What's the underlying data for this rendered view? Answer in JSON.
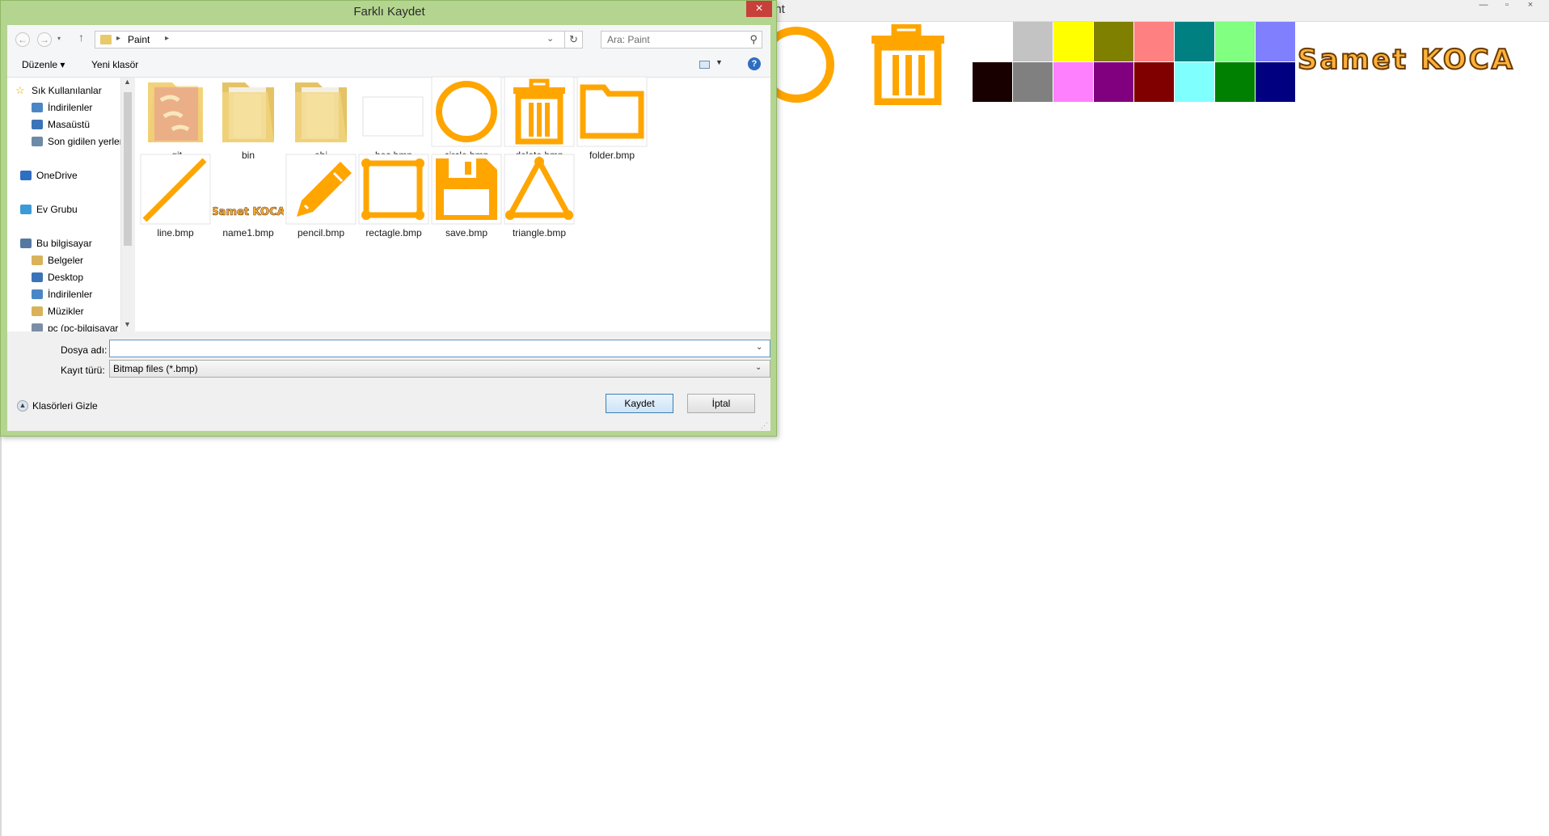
{
  "paint_app": {
    "title_fragment": "int",
    "logo_text": "Samet KOCA",
    "palette": [
      "#c3c3c3",
      "#ffff00",
      "#808000",
      "#ff8080",
      "#008080",
      "#80ff80",
      "#8080ff",
      "#180000",
      "#808080",
      "#ff80ff",
      "#800080",
      "#800000",
      "#80ffff",
      "#008000",
      "#000080"
    ],
    "accent": "#ffa500"
  },
  "dialog": {
    "title": "Farklı Kaydet",
    "close": "×",
    "address": {
      "folder": "Paint",
      "sep": "▸"
    },
    "search_placeholder": "Ara: Paint",
    "toolbar": {
      "organize": "Düzenle ▾",
      "new_folder": "Yeni klasör",
      "help": "?"
    },
    "nav_tree": [
      {
        "label": "Sık Kullanılanlar",
        "icon": "star-icon"
      },
      {
        "label": "İndirilenler",
        "icon": "downloads-icon"
      },
      {
        "label": "Masaüstü",
        "icon": "desktop-icon"
      },
      {
        "label": "Son gidilen yerler",
        "icon": "recent-icon"
      },
      {
        "label": "OneDrive",
        "icon": "cloud-icon"
      },
      {
        "label": "Ev Grubu",
        "icon": "homegroup-icon"
      },
      {
        "label": "Bu bilgisayar",
        "icon": "computer-icon"
      },
      {
        "label": "Belgeler",
        "icon": "documents-icon"
      },
      {
        "label": "Desktop",
        "icon": "desktop-icon"
      },
      {
        "label": "İndirilenler",
        "icon": "downloads-icon"
      },
      {
        "label": "Müzikler",
        "icon": "music-icon"
      },
      {
        "label": "pc (pc-bilgisayar",
        "icon": "network-drive-icon"
      }
    ],
    "files": [
      {
        "name": ".git",
        "kind": "git-folder"
      },
      {
        "name": "bin",
        "kind": "folder"
      },
      {
        "name": "obj",
        "kind": "folder"
      },
      {
        "name": "bos.bmp",
        "kind": "blank"
      },
      {
        "name": "circle.bmp",
        "kind": "circle"
      },
      {
        "name": "delete.bmp",
        "kind": "trash"
      },
      {
        "name": "folder.bmp",
        "kind": "folder-outline"
      },
      {
        "name": "line.bmp",
        "kind": "line"
      },
      {
        "name": "name1.bmp",
        "kind": "name"
      },
      {
        "name": "pencil.bmp",
        "kind": "pencil"
      },
      {
        "name": "rectagle.bmp",
        "kind": "rectangle"
      },
      {
        "name": "save.bmp",
        "kind": "floppy"
      },
      {
        "name": "triangle.bmp",
        "kind": "triangle"
      }
    ],
    "filename_label": "Dosya adı:",
    "filename_value": "",
    "type_label": "Kayıt türü:",
    "type_value": "Bitmap files (*.bmp)",
    "hide_folders": "Klasörleri Gizle",
    "save_button": "Kaydet",
    "cancel_button": "İptal"
  }
}
